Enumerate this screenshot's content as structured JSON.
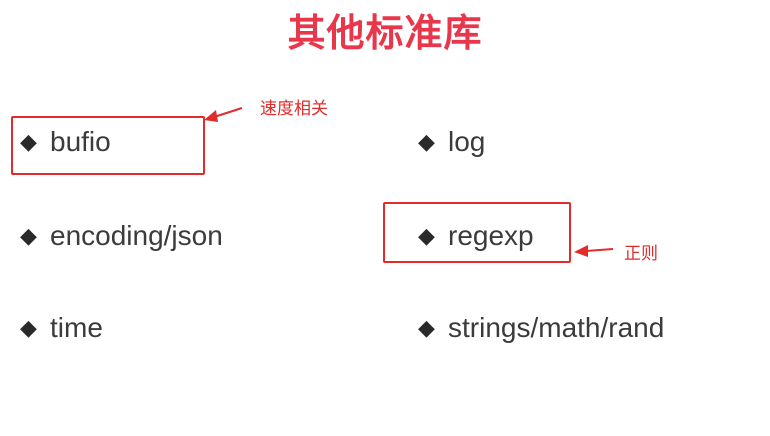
{
  "title": "其他标准库",
  "bullet_glyph": "◆",
  "items": {
    "bufio": "bufio",
    "encoding_json": "encoding/json",
    "time": "time",
    "log": "log",
    "regexp": "regexp",
    "strings_math_rand": "strings/math/rand"
  },
  "annotations": {
    "speed": "速度相关",
    "regex": "正则"
  },
  "colors": {
    "title": "#e8364a",
    "annotation": "#e22b2b",
    "text": "#3b3b3b"
  }
}
